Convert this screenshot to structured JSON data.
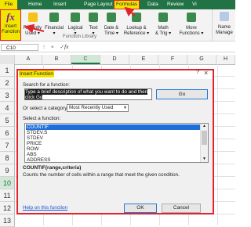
{
  "ribbon": {
    "tabs": [
      {
        "label": "File"
      },
      {
        "label": "Home"
      },
      {
        "label": "Insert"
      },
      {
        "label": "Page Layout"
      },
      {
        "label": "Formulas"
      },
      {
        "label": "Data"
      },
      {
        "label": "Review"
      },
      {
        "label": "Vi"
      }
    ],
    "insert_function": {
      "icon": "fx",
      "label": "Insert\nFunction"
    },
    "buttons": [
      {
        "label": "Recently\nUsed ▾",
        "icon": "star-icon"
      },
      {
        "label": "Financial\n▾",
        "icon": "book-icon"
      },
      {
        "label": "Logical\n▾",
        "icon": "book-icon"
      },
      {
        "label": "Text\n▾",
        "icon": "book-icon"
      },
      {
        "label": "Date &\nTime ▾",
        "icon": "book-icon"
      },
      {
        "label": "Lookup &\nReference ▾",
        "icon": "book-icon"
      },
      {
        "label": "Math\n& Trig ▾",
        "icon": "book-icon"
      },
      {
        "label": "More\nFunctions ▾",
        "icon": "book-icon"
      },
      {
        "label": "Name\nManage",
        "icon": "tag-icon"
      }
    ],
    "group_label": "Function Library"
  },
  "formula_bar": {
    "name_box": "C10",
    "icons": "⁝ × ✓",
    "fx": "fx",
    "value": ""
  },
  "grid": {
    "columns": [
      "A",
      "B",
      "C",
      "D",
      "E",
      "F",
      "G",
      "H"
    ],
    "rows": [
      "1",
      "2",
      "3",
      "4",
      "5",
      "6",
      "7",
      "8",
      "9",
      "10",
      "11",
      "12",
      "13"
    ],
    "selected_column": "C",
    "selected_row": "10"
  },
  "dialog": {
    "title": "Insert Function",
    "help": "?",
    "close": "×",
    "search_label": "Search for a function:",
    "search_value": "Type a brief description of what you want to do and then click Go",
    "go_label": "Go",
    "category_label": "Or select a category:",
    "category_value": "Most Recently Used",
    "function_label": "Select a function:",
    "functions": [
      "COUNTIF",
      "STDEV.S",
      "STDEV",
      "PRICE",
      "ROW",
      "ABS",
      "ADDRESS"
    ],
    "selected_function": "COUNTIF",
    "syntax": "COUNTIF(range,criteria)",
    "description": "Counts the number of cells within a range that meet the given condition.",
    "help_link": "Help on this function",
    "ok_label": "OK",
    "cancel_label": "Cancel"
  },
  "colors": {
    "excel_green": "#217346",
    "highlight_yellow": "#f2e600",
    "annotation_red": "#e3222c",
    "selection_blue": "#1e6fd9"
  }
}
